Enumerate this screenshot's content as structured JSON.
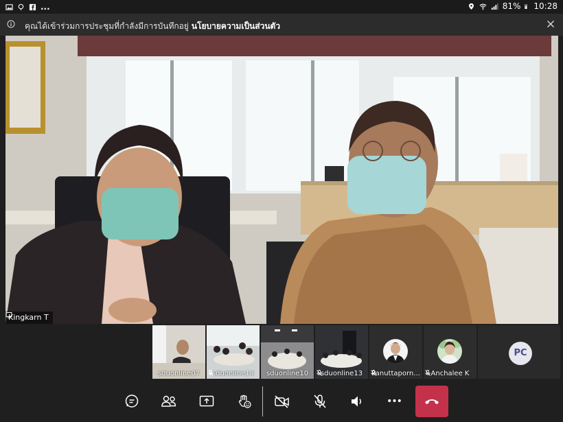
{
  "status_bar": {
    "left_icons": [
      "gallery-icon",
      "location-pin-icon",
      "facebook-icon"
    ],
    "left_more": "...",
    "battery": "81%",
    "time": "10:28"
  },
  "banner": {
    "message": "คุณได้เข้าร่วมการประชุมที่กำลังมีการบันทึกอยู่",
    "link": "นโยบายความเป็นส่วนตัว"
  },
  "main_video": {
    "participant_name": "Kingkarn T"
  },
  "thumbnails": [
    {
      "name": "sduonline07",
      "muted": false
    },
    {
      "name": "sduonline14",
      "muted": true
    },
    {
      "name": "sduonline10",
      "muted": false
    },
    {
      "name": "sduonline13",
      "muted": true
    },
    {
      "name": "Panuttaporn...",
      "muted": true
    },
    {
      "name": "Anchalee K",
      "muted": true
    }
  ],
  "overflow_participant": {
    "initials": "PC"
  },
  "toolbar": {
    "buttons": [
      "chat-icon",
      "participants-icon",
      "share-screen-icon",
      "raise-hand-icon",
      "camera-off-icon",
      "mic-off-icon",
      "speaker-icon",
      "more-icon",
      "hang-up-icon"
    ],
    "more_label": "•••"
  },
  "colors": {
    "hangup": "#c4314b",
    "background": "#1f1f1f",
    "avatar_bg": "#e6e6ee",
    "avatar_text": "#4a4d8a"
  }
}
